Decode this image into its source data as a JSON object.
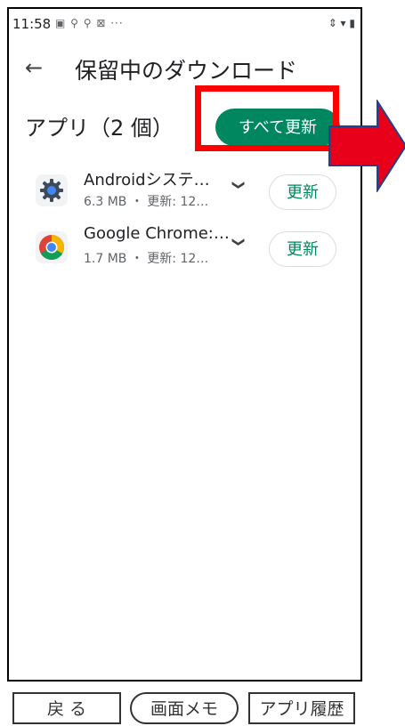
{
  "status_bar": {
    "time": "11:58",
    "left_icons": "▣ ⚲ ⚲ ⊠ ···",
    "right_icons": "⇕ ▾ ▮"
  },
  "app_bar": {
    "back_icon": "←",
    "title": "保留中のダウンロード"
  },
  "section": {
    "title": "アプリ（2 個）",
    "update_all_label": "すべて更新"
  },
  "apps": [
    {
      "name": "Androidシステ…",
      "meta": "6.3 MB ・ 更新: 12…",
      "icon": "gear-icon",
      "update_label": "更新"
    },
    {
      "name": "Google Chrome:…",
      "meta": "1.7 MB ・ 更新: 12…",
      "icon": "chrome-icon",
      "update_label": "更新"
    }
  ],
  "bottom_nav": {
    "back": "戻 る",
    "memo": "画面メモ",
    "history": "アプリ履歴"
  },
  "colors": {
    "accent": "#01875f",
    "highlight": "#ff0000",
    "arrow_fill": "#e8001a",
    "arrow_stroke": "#1f3f8f"
  }
}
